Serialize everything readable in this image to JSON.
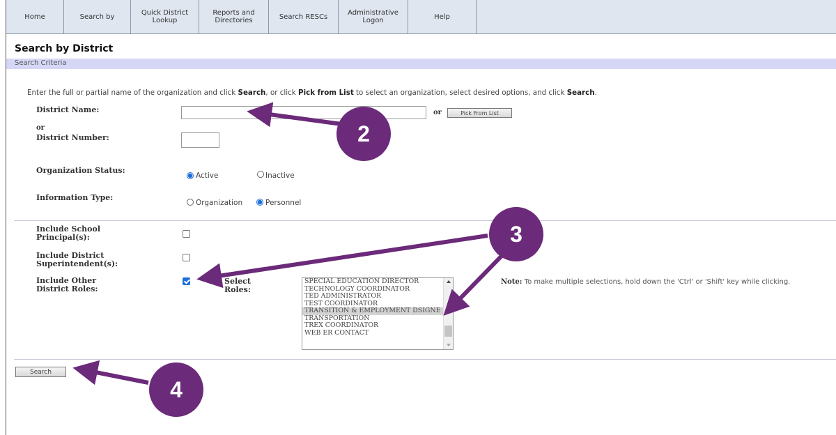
{
  "nav": [
    {
      "label": "Home"
    },
    {
      "label": "Search by"
    },
    {
      "label": "Quick District\nLookup"
    },
    {
      "label": "Reports and\nDirectories"
    },
    {
      "label": "Search RESCs"
    },
    {
      "label": "Administrative\nLogon"
    },
    {
      "label": "Help"
    }
  ],
  "page": {
    "title": "Search by District",
    "criteria_label": "Search Criteria",
    "instructions": {
      "part1": "Enter the full or partial name of the organization and click ",
      "bold1": "Search",
      "part2": ", or click ",
      "bold2": "Pick from List",
      "part3": " to select an organization, select desired options, and click ",
      "bold3": "Search",
      "part4": "."
    }
  },
  "form": {
    "district_name_label": "District Name:",
    "district_name_value": "",
    "or_label": "or",
    "or_label2": "or",
    "pick_button": "Pick From List",
    "district_number_label": "District Number:",
    "district_number_value": "",
    "org_status_label": "Organization Status:",
    "status_active": "Active",
    "status_inactive": "Inactive",
    "info_type_label": "Information Type:",
    "info_org": "Organization",
    "info_personnel": "Personnel",
    "principal_label_1": "Include School",
    "principal_label_2": "Principal(s):",
    "super_label_1": "Include District",
    "super_label_2": "Superintendent(s):",
    "other_label_1": "Include Other",
    "other_label_2": "District Roles:",
    "select_roles_1": "Select",
    "select_roles_2": "Roles:",
    "roles": [
      "SPECIAL EDUCATION DIRECTOR",
      "TECHNOLOGY COORDINATOR",
      "TED ADMINISTRATOR",
      "TEST COORDINATOR",
      "TRANSITION & EMPLOYMENT DSIGNE",
      "TRANSPORTATION",
      "TREX COORDINATOR",
      "WEB ER CONTACT"
    ],
    "selected_role": "TRANSITION & EMPLOYMENT DSIGNE",
    "note_bold": "Note:",
    "note_text": " To make multiple selections, hold down the 'Ctrl' or 'Shift' key while clicking.",
    "search_button": "Search"
  },
  "state": {
    "status": "Active",
    "info_type": "Personnel",
    "include_principals": false,
    "include_superintendents": false,
    "include_other_roles": true
  },
  "annotations": {
    "badge2": "2",
    "badge3": "3",
    "badge4": "4",
    "color": "#6b2a7a"
  }
}
